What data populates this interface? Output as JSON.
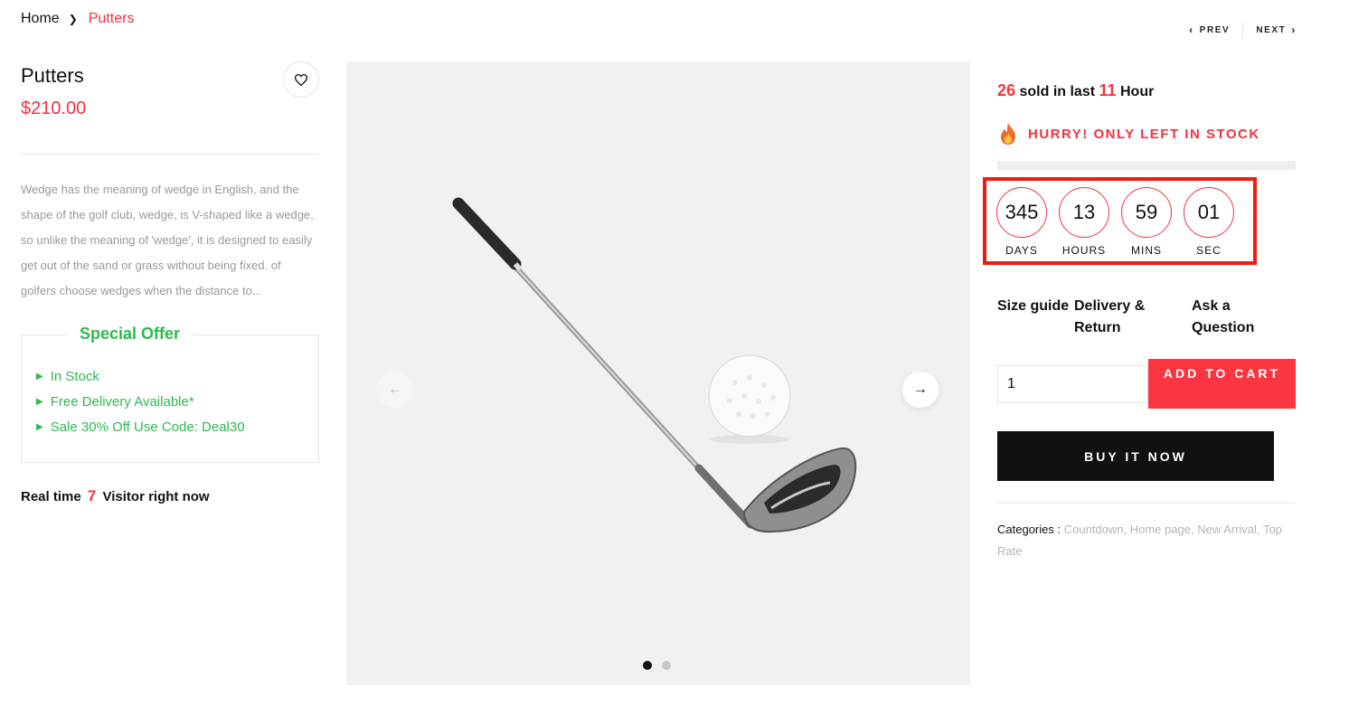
{
  "breadcrumb": {
    "home": "Home",
    "separator": "›",
    "current": "Putters"
  },
  "pager": {
    "prev": "PREV",
    "next": "NEXT"
  },
  "product": {
    "title": "Putters",
    "price": "$210.00",
    "description": "Wedge has the meaning of wedge in English, and the shape of the golf club, wedge, is V-shaped like a wedge, so unlike the meaning of 'wedge', it is designed to easily get out of the sand or grass without being fixed. of golfers choose wedges when the distance to..."
  },
  "special_offer": {
    "title": "Special Offer",
    "items": [
      "In Stock",
      "Free Delivery Available*",
      "Sale 30% Off Use Code: Deal30"
    ]
  },
  "visitors": {
    "prefix": "Real time",
    "count": "7",
    "suffix": "Visitor right now"
  },
  "sold": {
    "count": "26",
    "mid": "sold in last",
    "hours": "11",
    "suffix": "Hour"
  },
  "hurry": {
    "text": "HURRY! ONLY LEFT IN STOCK",
    "icon": "fire-icon"
  },
  "countdown": {
    "days": {
      "value": "345",
      "label": "DAYS"
    },
    "hours": {
      "value": "13",
      "label": "HOURS"
    },
    "mins": {
      "value": "59",
      "label": "MINS"
    },
    "secs": {
      "value": "01",
      "label": "SEC"
    }
  },
  "links": {
    "size_guide": "Size guide",
    "delivery": "Delivery & Return",
    "ask": "Ask a Question"
  },
  "cart": {
    "quantity": "1",
    "add_label": "ADD TO CART",
    "buy_label": "BUY IT NOW"
  },
  "categories": {
    "label": "Categories :",
    "items": [
      "Countdown,",
      "Home page,",
      "New Arrival,",
      "Top Rate"
    ]
  },
  "gallery": {
    "slides": 2,
    "active_slide": 1
  },
  "colors": {
    "accent": "#f2333e",
    "green": "#2db94d",
    "highlight_border": "#ee1c10",
    "dark": "#111111"
  }
}
